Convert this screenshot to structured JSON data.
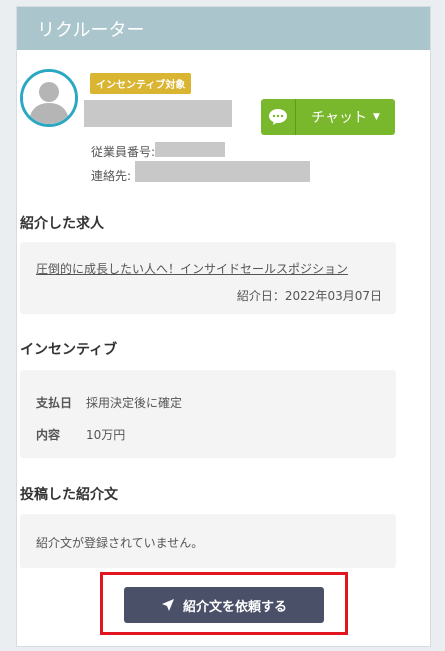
{
  "header": {
    "title": "リクルーター"
  },
  "profile": {
    "badge": "インセンティブ対象",
    "employee_no_label": "従業員番号:",
    "contact_label": "連絡先:"
  },
  "chat_button": {
    "label": "チャット"
  },
  "referred_job": {
    "title": "紹介した求人",
    "job_link": "圧倒的に成長したい人へ！インサイドセールスポジション",
    "date_text": "紹介日：2022年03月07日"
  },
  "incentive": {
    "title": "インセンティブ",
    "rows": [
      {
        "label": "支払日",
        "value": "採用決定後に確定"
      },
      {
        "label": "内容",
        "value": "10万円"
      }
    ]
  },
  "posted_intro": {
    "title": "投稿した紹介文",
    "empty_message": "紹介文が登録されていません。"
  },
  "request_button": {
    "label": "紹介文を依頼する"
  },
  "colors": {
    "header_bg": "#aac5cb",
    "chat_green": "#79b82d",
    "badge_gold": "#d9b531",
    "button_dark": "#4a5068",
    "highlight_red": "#e0151f"
  }
}
